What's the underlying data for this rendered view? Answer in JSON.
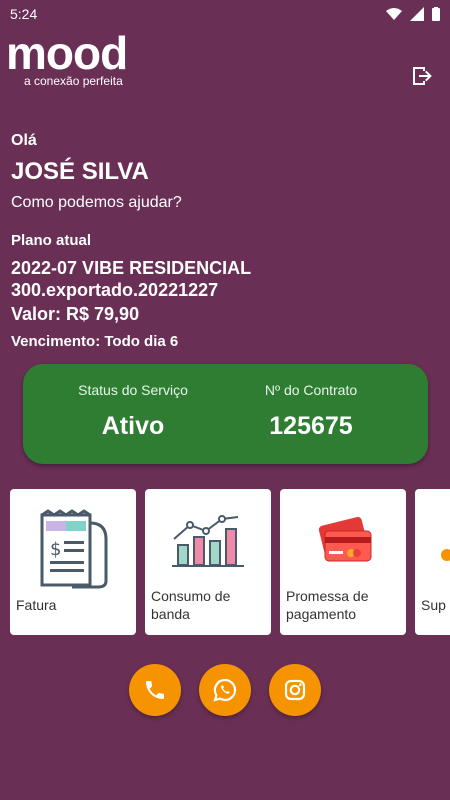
{
  "status_bar": {
    "time": "5:24"
  },
  "brand": {
    "logo": "mood",
    "tagline": "a conexão perfeita"
  },
  "header": {
    "logout_icon": "logout-icon"
  },
  "greeting": {
    "hello": "Olá",
    "name": "JOSÉ SILVA",
    "help": "Como podemos ajudar?"
  },
  "plan": {
    "label": "Plano atual",
    "name": "2022-07 VIBE RESIDENCIAL 300.exportado.20221227",
    "value": "Valor: R$ 79,90",
    "due": "Vencimento: Todo dia 6"
  },
  "service": {
    "status_label": "Status do Serviço",
    "status_value": "Ativo",
    "contract_label": "Nº do Contrato",
    "contract_value": "125675",
    "card_color": "#2e7d32"
  },
  "tiles": [
    {
      "label": "Fatura",
      "icon": "invoice-icon"
    },
    {
      "label": "Consumo de banda",
      "icon": "bandwidth-chart-icon"
    },
    {
      "label": "Promessa de pagamento",
      "icon": "credit-card-icon"
    },
    {
      "label": "Sup",
      "icon": "support-icon"
    }
  ],
  "actions": [
    {
      "icon": "phone-icon"
    },
    {
      "icon": "whatsapp-icon"
    },
    {
      "icon": "instagram-icon"
    }
  ],
  "colors": {
    "background": "#6a2f55",
    "accent": "#f59300"
  }
}
